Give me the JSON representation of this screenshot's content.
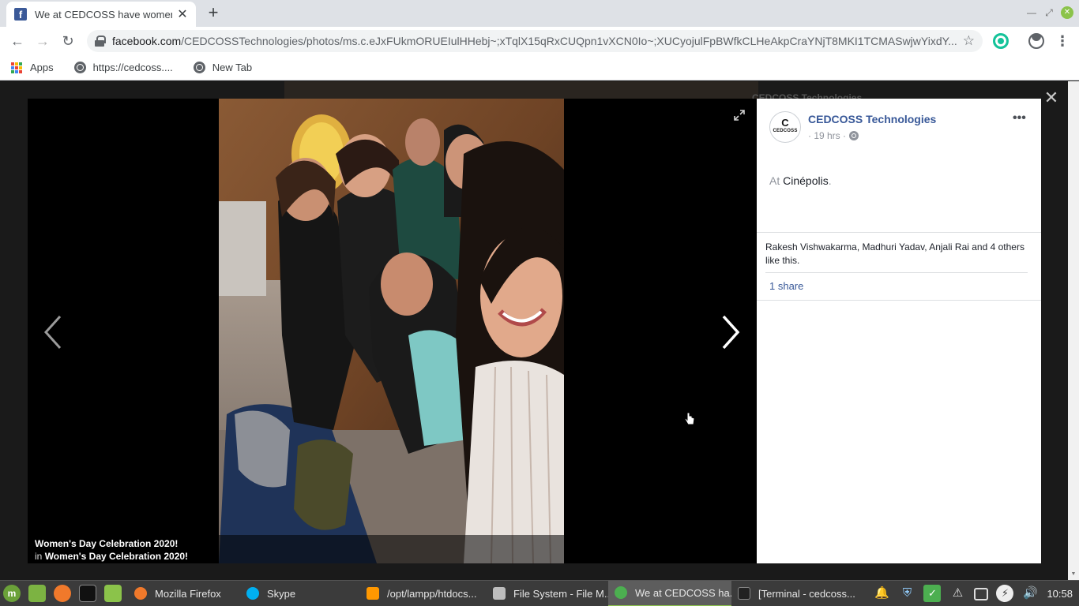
{
  "browser": {
    "tab_title": "We at CEDCOSS have women",
    "url_host": "facebook.com",
    "url_path": "/CEDCOSSTechnologies/photos/ms.c.eJxFUkmORUEIulHHebj~;xTqlX15qRxCUQpn1vXCN0Io~;XUCyojulFpBWfkCLHeAkpCraYNjT8MKI1TCMASwjwYixdY...",
    "bookmarks": [
      {
        "label": "Apps",
        "icon": "apps-grid-icon"
      },
      {
        "label": "https://cedcoss....",
        "icon": "globe-icon"
      },
      {
        "label": "New Tab",
        "icon": "globe-icon"
      }
    ]
  },
  "viewer": {
    "background_page_name": "CEDCOSS Technologies",
    "caption_title": "Women's Day Celebration 2020!",
    "caption_in_prefix": "in",
    "caption_album": "Women's Day Celebration 2020!"
  },
  "post": {
    "avatar_letter": "C",
    "avatar_text": "CEDCOSS",
    "page_name": "CEDCOSS Technologies",
    "time": "· 19 hrs ·",
    "location_prefix": "At",
    "location_place": "Cinépolis",
    "location_suffix": ".",
    "likes_text": "Rakesh Vishwakarma, Madhuri Yadav, Anjali Rai and 4 others like this.",
    "shares_text": "1 share",
    "more_label": "•••"
  },
  "taskbar": {
    "items": [
      {
        "label": "Mozilla Firefox",
        "color": "#f0792b"
      },
      {
        "label": "Skype",
        "color": "#00aff0"
      },
      {
        "label": "/opt/lampp/htdocs...",
        "color": "#ff9800"
      },
      {
        "label": "File System - File M...",
        "color": "#bdbdbd"
      },
      {
        "label": "We at CEDCOSS ha...",
        "color": "#4caf50"
      },
      {
        "label": "[Terminal - cedcoss...",
        "color": "#222222"
      }
    ],
    "clock": "10:58"
  },
  "colors": {
    "facebook_blue": "#385898",
    "taskbar_bg": "#3b3b3b",
    "mint_green": "#8bc34a"
  }
}
